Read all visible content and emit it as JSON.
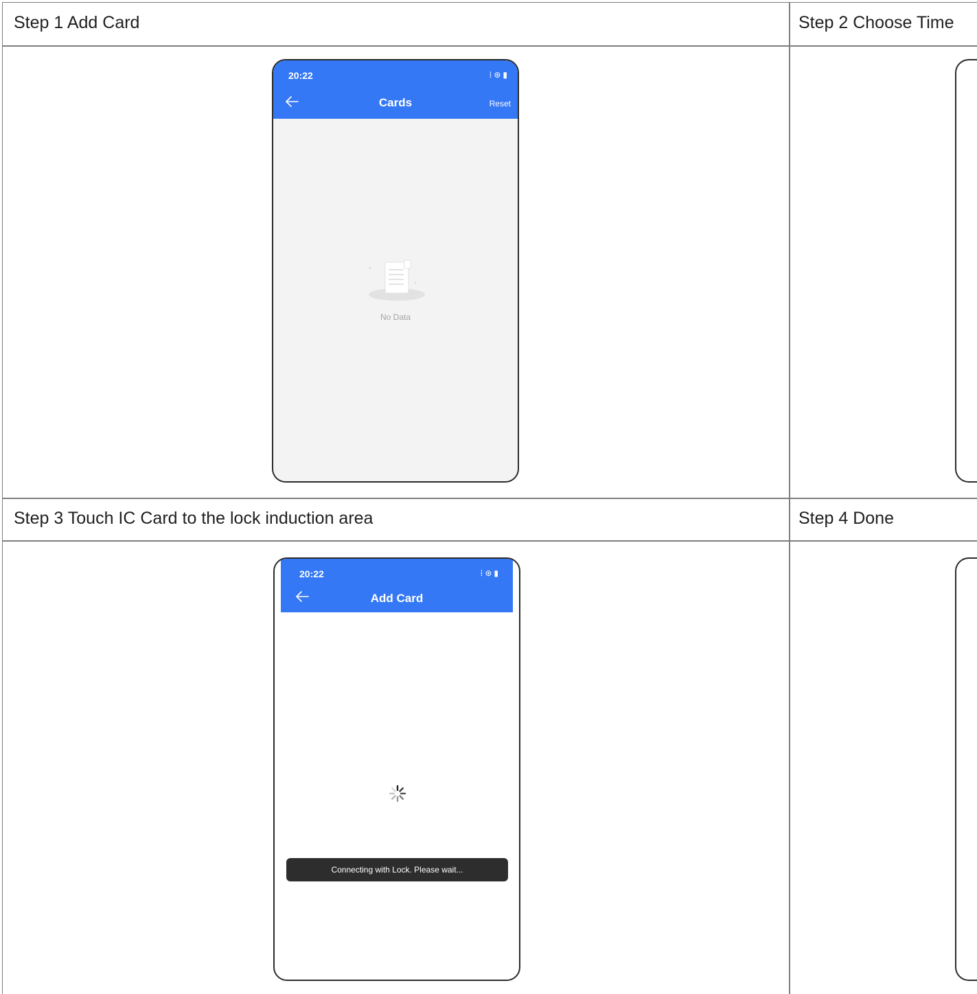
{
  "steps": [
    {
      "label": "Step 1 Add Card"
    },
    {
      "label": "Step 2 Choose Time"
    },
    {
      "label": "Step 3 Touch IC Card to the lock induction area"
    },
    {
      "label": "Step 4 Done"
    }
  ],
  "screen1": {
    "status_time": "20:22",
    "status_icons": "signal-icon wifi-icon battery-icon",
    "title": "Cards",
    "reset_label": "Reset",
    "empty_text": "No Data"
  },
  "screen3": {
    "status_time": "20:22",
    "status_icons": "signal-icon wifi-icon battery-icon",
    "title": "Add Card",
    "toast_text": "Connecting with Lock. Please wait..."
  },
  "colors": {
    "app_bar": "#3478f6",
    "toast_bg": "#2d2d2d",
    "grid_line": "#7d7d7d"
  }
}
